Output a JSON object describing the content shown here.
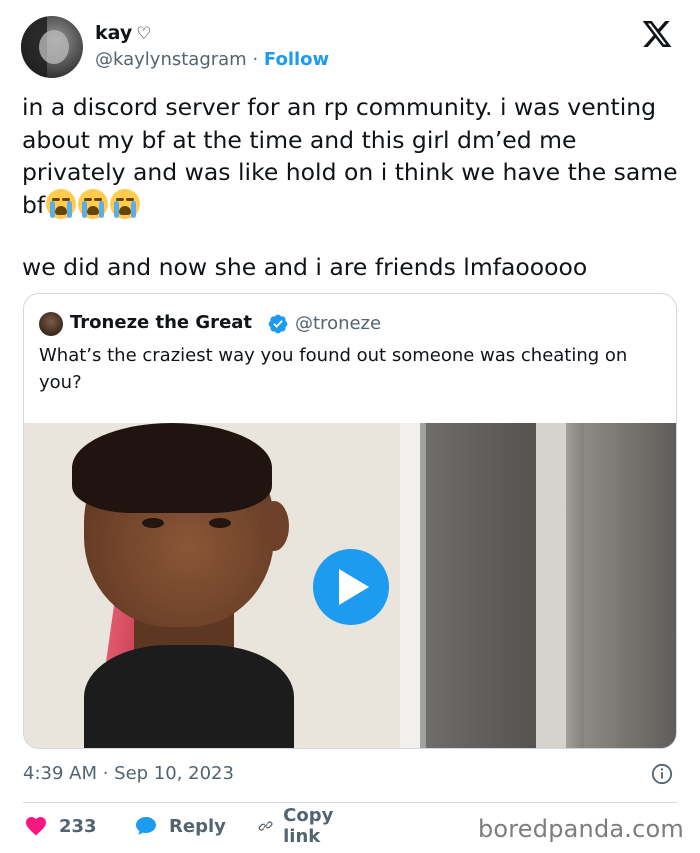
{
  "author": {
    "name": "kay",
    "heart": "♡",
    "handle": "@kaylynstagram",
    "separator": " · ",
    "follow_label": "Follow"
  },
  "tweet": {
    "paragraph1": "in a discord server for an rp community. i was venting about my bf at the time and this girl dm’ed me privately and was like hold on i think we have the same bf",
    "paragraph2": "we did and now she and i are friends lmfaooooo",
    "emoji": "loudly-crying-face-emoji ×3"
  },
  "quoted_tweet": {
    "name": "Troneze the Great",
    "handle": "@troneze",
    "text": "What’s the craziest way you found out someone was cheating on you?",
    "media": "video"
  },
  "meta": {
    "timestamp": "4:39 AM · Sep 10, 2023"
  },
  "actions": {
    "like_count": "233",
    "reply_label": "Reply",
    "copy_link_label": "Copy link"
  },
  "watermark": "boredpanda.com",
  "colors": {
    "accent": "#1d9bf0",
    "like": "#f91880",
    "secondary_text": "#536471",
    "border": "#cfd9de"
  },
  "icons": [
    "x-logo-icon",
    "verified-badge-icon",
    "play-icon",
    "info-icon",
    "heart-icon",
    "reply-bubble-icon",
    "link-icon"
  ]
}
